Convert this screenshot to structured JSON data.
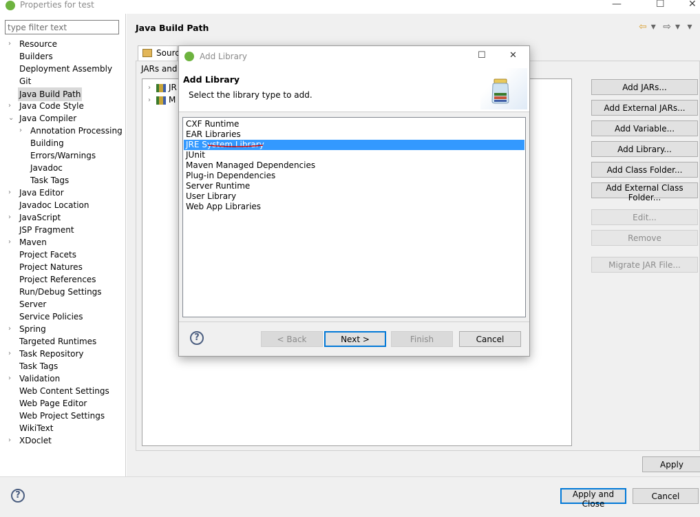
{
  "window": {
    "title": "Properties for test",
    "minimize_glyph": "—",
    "maximize_glyph": "☐",
    "close_glyph": "✕"
  },
  "filter": {
    "placeholder": "type filter text",
    "value": ""
  },
  "tree": {
    "expand_glyph": "›",
    "collapse_glyph": "⌄",
    "items": [
      {
        "label": "Resource"
      },
      {
        "label": "Builders"
      },
      {
        "label": "Deployment Assembly"
      },
      {
        "label": "Git"
      },
      {
        "label": "Java Build Path"
      },
      {
        "label": "Java Code Style"
      },
      {
        "label": "Java Compiler"
      },
      {
        "label": "Annotation Processing"
      },
      {
        "label": "Building"
      },
      {
        "label": "Errors/Warnings"
      },
      {
        "label": "Javadoc"
      },
      {
        "label": "Task Tags"
      },
      {
        "label": "Java Editor"
      },
      {
        "label": "Javadoc Location"
      },
      {
        "label": "JavaScript"
      },
      {
        "label": "JSP Fragment"
      },
      {
        "label": "Maven"
      },
      {
        "label": "Project Facets"
      },
      {
        "label": "Project Natures"
      },
      {
        "label": "Project References"
      },
      {
        "label": "Run/Debug Settings"
      },
      {
        "label": "Server"
      },
      {
        "label": "Service Policies"
      },
      {
        "label": "Spring"
      },
      {
        "label": "Targeted Runtimes"
      },
      {
        "label": "Task Repository"
      },
      {
        "label": "Task Tags"
      },
      {
        "label": "Validation"
      },
      {
        "label": "Web Content Settings"
      },
      {
        "label": "Web Page Editor"
      },
      {
        "label": "Web Project Settings"
      },
      {
        "label": "WikiText"
      },
      {
        "label": "XDoclet"
      }
    ]
  },
  "page": {
    "title": "Java Build Path",
    "nav": {
      "back": "⇦",
      "forward": "⇨",
      "dropdown": "▾",
      "menu": "▾"
    },
    "tab_source": "Source",
    "jars_label": "JARs and",
    "lib_rows": [
      {
        "label": "JR"
      },
      {
        "label": "M"
      }
    ],
    "buttons": {
      "add_jars": "Add JARs...",
      "add_external_jars": "Add External JARs...",
      "add_variable": "Add Variable...",
      "add_library": "Add Library...",
      "add_class_folder": "Add Class Folder...",
      "add_external_class_folder": "Add External Class Folder...",
      "edit": "Edit...",
      "remove": "Remove",
      "migrate_jar": "Migrate JAR File..."
    },
    "apply": "Apply"
  },
  "bottom": {
    "help": "?",
    "apply_and_close": "Apply and Close",
    "cancel": "Cancel"
  },
  "dialog": {
    "title": "Add Library",
    "heading": "Add Library",
    "description": "Select the library type to add.",
    "items": [
      {
        "label": "CXF Runtime"
      },
      {
        "label": "EAR Libraries"
      },
      {
        "label": "JRE System Library",
        "selected": true
      },
      {
        "label": "JUnit"
      },
      {
        "label": "Maven Managed Dependencies"
      },
      {
        "label": "Plug-in Dependencies"
      },
      {
        "label": "Server Runtime"
      },
      {
        "label": "User Library"
      },
      {
        "label": "Web App Libraries"
      }
    ],
    "help": "?",
    "back": "< Back",
    "next": "Next >",
    "finish": "Finish",
    "cancel": "Cancel"
  },
  "colors": {
    "selection": "#3399ff",
    "default_button_border": "#0078d7",
    "annotation": "#cc0000"
  }
}
